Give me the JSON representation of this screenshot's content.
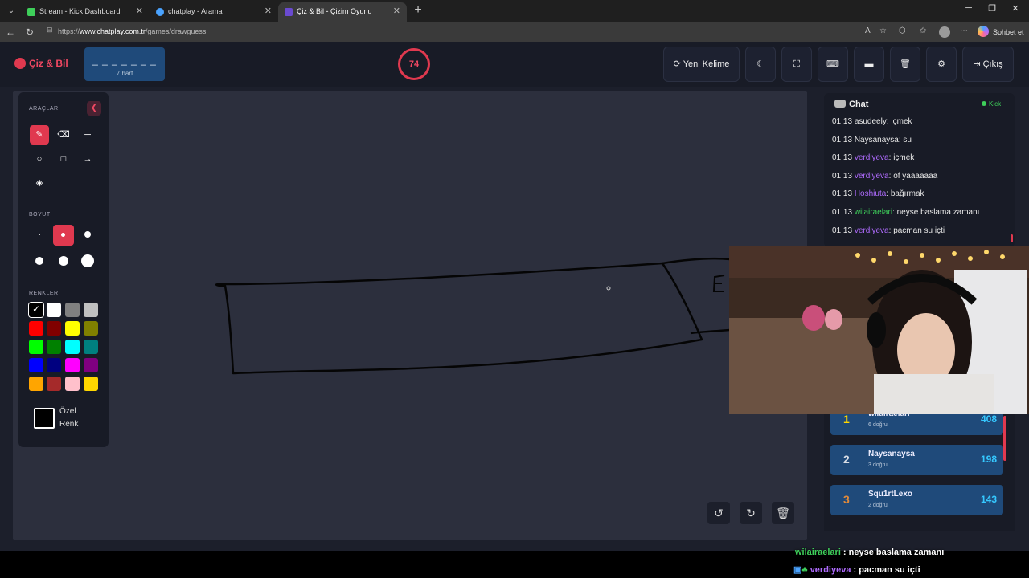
{
  "browser": {
    "tabs": [
      {
        "title": "Stream - Kick Dashboard",
        "active": false
      },
      {
        "title": "chatplay - Arama",
        "active": false
      },
      {
        "title": "Çiz & Bil - Çizim Oyunu",
        "active": true
      }
    ],
    "url_prefix": "https://",
    "url_domain": "www.chatplay.com.tr",
    "url_path": "/games/drawguess",
    "sidebar_button": "Sohbet et"
  },
  "header": {
    "logo": "Çiz & Bil",
    "word_dashes": "_ _ _ _ _ _ _",
    "word_hint": "7 harf",
    "timer": "74",
    "new_word_label": "Yeni Kelime",
    "logout_label": "Çıkış"
  },
  "tools": {
    "tools_label": "ARAÇLAR",
    "size_label": "BOYUT",
    "colors_label": "RENKLER",
    "custom_color_label": "Özel Renk",
    "items": [
      {
        "name": "pen",
        "icon": "pen-icon",
        "active": true
      },
      {
        "name": "eraser",
        "icon": "eraser-icon",
        "active": false
      },
      {
        "name": "line",
        "icon": "line-icon",
        "active": false
      },
      {
        "name": "circle",
        "icon": "circle-icon",
        "active": false
      },
      {
        "name": "rectangle",
        "icon": "rectangle-icon",
        "active": false
      },
      {
        "name": "arrow",
        "icon": "arrow-icon",
        "active": false
      },
      {
        "name": "fill",
        "icon": "fill-bucket-icon",
        "active": false
      }
    ],
    "sizes": [
      {
        "level": 1,
        "active": false
      },
      {
        "level": 2,
        "active": true
      },
      {
        "level": 3,
        "active": false
      },
      {
        "level": 4,
        "active": false
      },
      {
        "level": 5,
        "active": false
      },
      {
        "level": 6,
        "active": false
      }
    ],
    "colors": [
      "#000000",
      "#ffffff",
      "#808080",
      "#c0c0c0",
      "#ff0000",
      "#800000",
      "#ffff00",
      "#808000",
      "#00ff00",
      "#008000",
      "#00ffff",
      "#008080",
      "#0000ff",
      "#000080",
      "#ff00ff",
      "#800080",
      "#ffa500",
      "#a52a2a",
      "#ffc0cb",
      "#ffd700"
    ],
    "selected_color": "#000000"
  },
  "chat": {
    "title": "Chat",
    "source": "Kick",
    "messages": [
      {
        "time": "01:13",
        "user": "asudeely",
        "text": "içmek",
        "user_color": "#e8e8e8"
      },
      {
        "time": "01:13",
        "user": "Naysanaysa",
        "text": "su",
        "user_color": "#e8e8e8"
      },
      {
        "time": "01:13",
        "user": "verdiyeva",
        "text": "içmek",
        "user_color": "#b06cff"
      },
      {
        "time": "01:13",
        "user": "verdiyeva",
        "text": "of yaaaaaaa",
        "user_color": "#b06cff"
      },
      {
        "time": "01:13",
        "user": "Hoshiuta",
        "text": "bağırmak",
        "user_color": "#b06cff"
      },
      {
        "time": "01:13",
        "user": "wilairaelari",
        "text": "neyse baslama zamanı",
        "user_color": "#3ecf5a"
      },
      {
        "time": "01:13",
        "user": "verdiyeva",
        "text": "pacman su içti",
        "user_color": "#b06cff"
      }
    ]
  },
  "leaderboard": [
    {
      "rank": "1",
      "name": "wilairaelari",
      "correct": "6 doğru",
      "score": "408",
      "rank_color": "#ffd700"
    },
    {
      "rank": "2",
      "name": "Naysanaysa",
      "correct": "3 doğru",
      "score": "198",
      "rank_color": "#d8dde5"
    },
    {
      "rank": "3",
      "name": "Squ1rtLexo",
      "correct": "2 doğru",
      "score": "143",
      "rank_color": "#e08a3a"
    }
  ],
  "overlay": [
    {
      "user": "wilairaelari",
      "text": "neyse baslama zamanı",
      "user_color": "#3ecf5a"
    },
    {
      "user": "verdiyeva",
      "text": "pacman su içti",
      "user_color": "#b06cff"
    }
  ],
  "colors": {
    "accent": "#e0394f",
    "panel": "#181b26",
    "canvas": "#2c2f3d",
    "highlight_blue": "#1f4a7a"
  }
}
